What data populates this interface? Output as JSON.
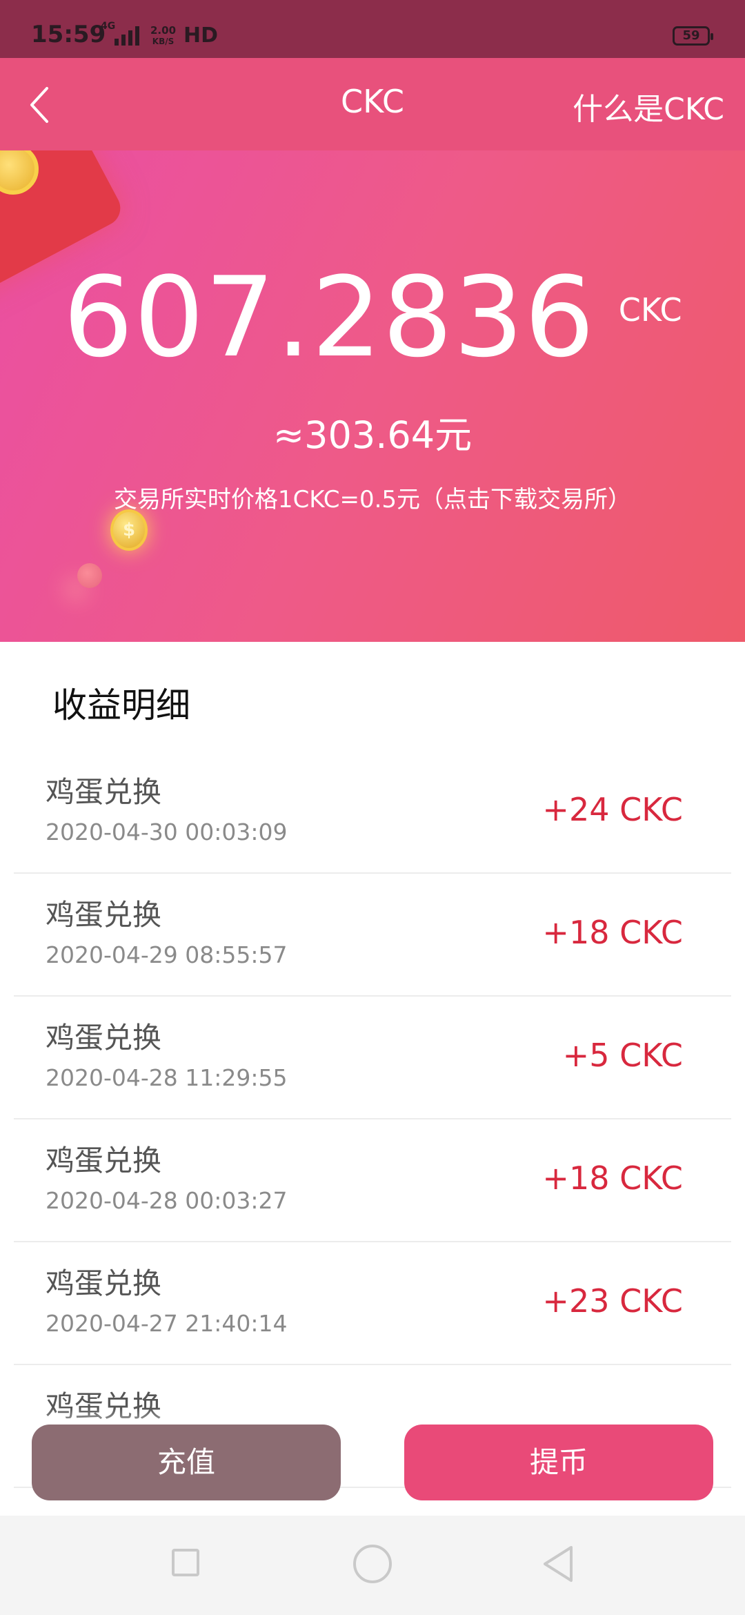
{
  "status_bar": {
    "time": "15:59",
    "network": "4G",
    "speed_top": "2.00",
    "speed_bottom": "KB/S",
    "hd": "HD",
    "battery": "59"
  },
  "nav": {
    "back_icon": "chevron-left-icon",
    "title": "CKC",
    "link": "什么是CKC"
  },
  "hero": {
    "balance": "607.2836",
    "unit": "CKC",
    "cny_value": "≈303.64元",
    "rate_text": "交易所实时价格1CKC=0.5元（点击下载交易所）"
  },
  "section_title": "收益明细",
  "transactions": [
    {
      "title": "鸡蛋兑换",
      "time": "2020-04-30 00:03:09",
      "amount": "+24 CKC"
    },
    {
      "title": "鸡蛋兑换",
      "time": "2020-04-29 08:55:57",
      "amount": "+18 CKC"
    },
    {
      "title": "鸡蛋兑换",
      "time": "2020-04-28 11:29:55",
      "amount": "+5 CKC"
    },
    {
      "title": "鸡蛋兑换",
      "time": "2020-04-28 00:03:27",
      "amount": "+18 CKC"
    },
    {
      "title": "鸡蛋兑换",
      "time": "2020-04-27 21:40:14",
      "amount": "+23 CKC"
    },
    {
      "title": "鸡蛋兑换",
      "time": "",
      "amount": ""
    }
  ],
  "buttons": {
    "recharge": "充值",
    "withdraw": "提币"
  },
  "colors": {
    "nav_bg": "#e8517c",
    "status_bg": "#8c2d4b",
    "amount": "#d8283e",
    "recharge_btn": "#8c6c72",
    "withdraw_btn": "#e94a78"
  },
  "system_nav": {
    "icons": [
      "square-icon",
      "circle-icon",
      "triangle-back-icon"
    ]
  }
}
